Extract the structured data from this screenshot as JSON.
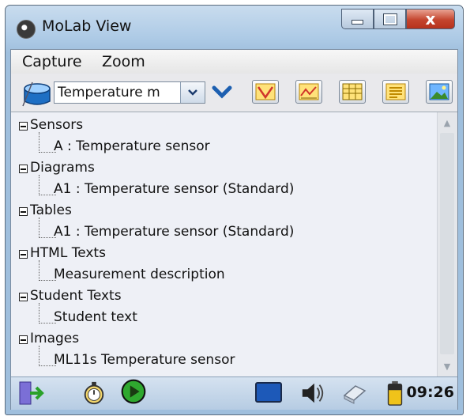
{
  "window": {
    "title": "MoLab View",
    "app_icon": "paw-icon",
    "controls": [
      "minimize-icon",
      "maximize-icon",
      "close-icon"
    ],
    "close_label": "x"
  },
  "menu": {
    "items": [
      "Capture",
      "Zoom"
    ]
  },
  "toolbar": {
    "selector_value": "Temperature m",
    "icons": [
      "database-icon",
      "chevron-down-icon",
      "diagram-icon",
      "line-chart-icon",
      "table-icon",
      "text-icon",
      "image-icon"
    ]
  },
  "tree": {
    "nodes": [
      {
        "label": "Sensors",
        "children": [
          "A : Temperature sensor"
        ]
      },
      {
        "label": "Diagrams",
        "children": [
          "A1 : Temperature sensor (Standard)"
        ]
      },
      {
        "label": "Tables",
        "children": [
          "A1 : Temperature sensor (Standard)"
        ]
      },
      {
        "label": "HTML Texts",
        "children": [
          "Measurement description"
        ]
      },
      {
        "label": "Student Texts",
        "children": [
          "Student text"
        ]
      },
      {
        "label": "Images",
        "children": [
          "ML11s Temperature sensor"
        ]
      }
    ]
  },
  "statusbar": {
    "icons": [
      "exit-icon",
      "stopwatch-icon",
      "play-icon",
      "screen-icon",
      "speaker-icon",
      "eraser-icon",
      "battery-icon"
    ],
    "time": "09:26"
  },
  "colors": {
    "title_bar": "#aecbe6",
    "close_button": "#c4452e",
    "play_green": "#2fa82f",
    "tree_background": "#eef0f6"
  }
}
